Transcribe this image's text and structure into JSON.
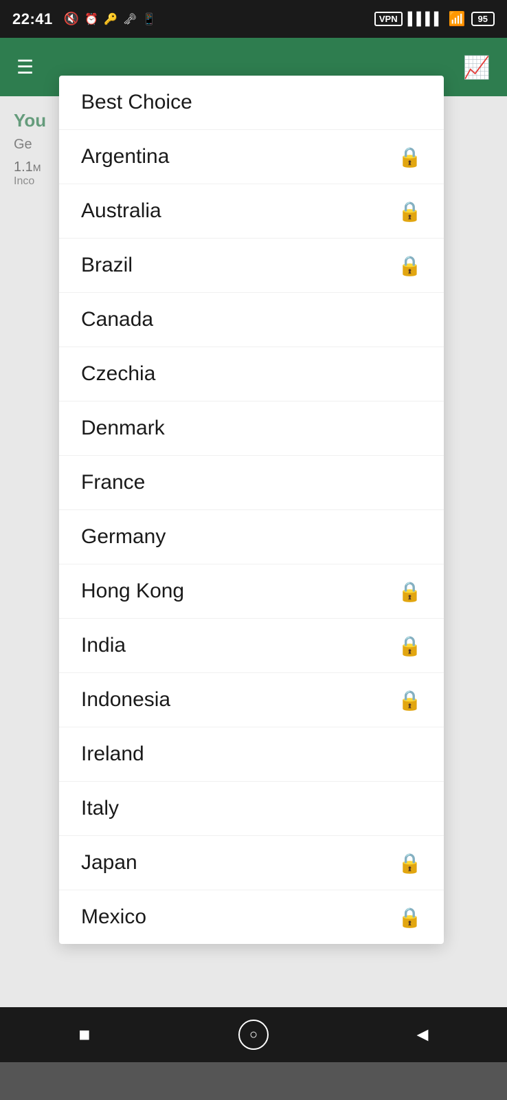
{
  "statusBar": {
    "time": "22:41",
    "vpnLabel": "VPN",
    "batteryLevel": "95"
  },
  "appHeader": {
    "menuIconLabel": "☰",
    "chartIconLabel": "↗"
  },
  "appBackground": {
    "youLabel": "You",
    "geLabel": "Ge",
    "statLabel": "1.1",
    "statSub": "Inco"
  },
  "dropdown": {
    "items": [
      {
        "id": "best-choice",
        "label": "Best Choice",
        "locked": false
      },
      {
        "id": "argentina",
        "label": "Argentina",
        "locked": true
      },
      {
        "id": "australia",
        "label": "Australia",
        "locked": true
      },
      {
        "id": "brazil",
        "label": "Brazil",
        "locked": true
      },
      {
        "id": "canada",
        "label": "Canada",
        "locked": false
      },
      {
        "id": "czechia",
        "label": "Czechia",
        "locked": false
      },
      {
        "id": "denmark",
        "label": "Denmark",
        "locked": false
      },
      {
        "id": "france",
        "label": "France",
        "locked": false
      },
      {
        "id": "germany",
        "label": "Germany",
        "locked": false
      },
      {
        "id": "hong-kong",
        "label": "Hong Kong",
        "locked": true
      },
      {
        "id": "india",
        "label": "India",
        "locked": true
      },
      {
        "id": "indonesia",
        "label": "Indonesia",
        "locked": true
      },
      {
        "id": "ireland",
        "label": "Ireland",
        "locked": false
      },
      {
        "id": "italy",
        "label": "Italy",
        "locked": false
      },
      {
        "id": "japan",
        "label": "Japan",
        "locked": true
      },
      {
        "id": "mexico",
        "label": "Mexico",
        "locked": true
      }
    ]
  },
  "navBar": {
    "stopLabel": "■",
    "homeLabel": "○",
    "backLabel": "◀"
  }
}
